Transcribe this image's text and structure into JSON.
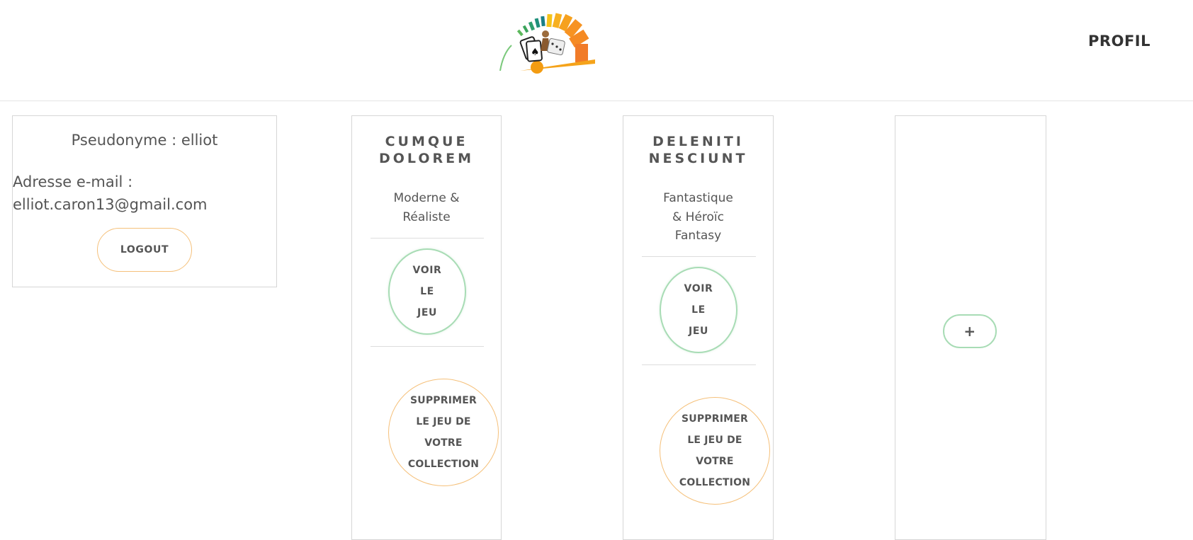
{
  "header": {
    "logo_name": "gaming-meter-logo",
    "nav_profil": "PROFIL"
  },
  "user": {
    "pseudo_label": "Pseudonyme : elliot",
    "email_label": "Adresse e-mail :",
    "email_value": "elliot.caron13@gmail.com",
    "logout_label": "LOGOUT"
  },
  "games": [
    {
      "title_line1": "CUMQUE",
      "title_line2": "DOLOREM",
      "genre_line1": "Moderne &",
      "genre_line2": "Réaliste",
      "voir_line1": "VOIR",
      "voir_line2": "LE",
      "voir_line3": "JEU",
      "del_line1": "SUPPRIMER",
      "del_line2": "LE JEU DE",
      "del_line3": "VOTRE",
      "del_line4": "COLLECTION"
    },
    {
      "title_line1": "DELENITI",
      "title_line2": "NESCIUNT",
      "genre_line1": "Fantastique",
      "genre_line2": "& Héroïc",
      "genre_line3": "Fantasy",
      "voir_line1": "VOIR",
      "voir_line2": "LE",
      "voir_line3": "JEU",
      "del_line1": "SUPPRIMER",
      "del_line2": "LE JEU DE",
      "del_line3": "VOTRE",
      "del_line4": "COLLECTION"
    }
  ],
  "add_label": "+",
  "colors": {
    "green": "#a8dcb5",
    "orange": "#f5c07a",
    "text": "#555555"
  }
}
